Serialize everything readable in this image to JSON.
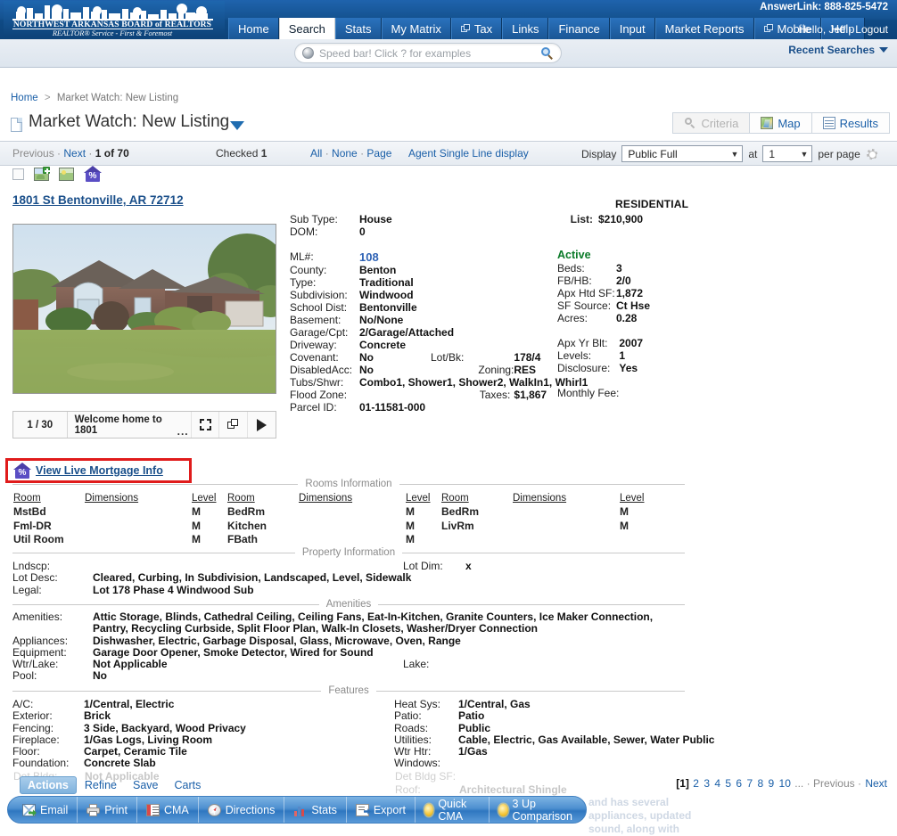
{
  "header": {
    "logo": {
      "line1": "NORTHWEST ARKANSAS BOARD of REALTORS",
      "line2": "REALTOR® Service - First & Foremost"
    },
    "nav": [
      {
        "label": "Home",
        "icon": "",
        "active": false
      },
      {
        "label": "Search",
        "icon": "",
        "active": true
      },
      {
        "label": "Stats",
        "icon": "",
        "active": false
      },
      {
        "label": "My Matrix",
        "icon": "",
        "active": false
      },
      {
        "label": "Tax",
        "icon": "window-icon",
        "active": false
      },
      {
        "label": "Links",
        "icon": "",
        "active": false
      },
      {
        "label": "Finance",
        "icon": "",
        "active": false
      },
      {
        "label": "Input",
        "icon": "",
        "active": false
      },
      {
        "label": "Market Reports",
        "icon": "",
        "active": false
      },
      {
        "label": "Mobile",
        "icon": "window-icon",
        "active": false
      },
      {
        "label": "Help",
        "icon": "",
        "active": false
      }
    ],
    "answerlink": "AnswerLink: 888-825-5472",
    "greeting": "Hello, Jeff",
    "greeting_sep": "·",
    "logout": "Logout"
  },
  "speedbar": {
    "placeholder": "Speed bar! Click ? for examples",
    "value": "",
    "recent_searches": "Recent Searches"
  },
  "breadcrumb": {
    "home": "Home",
    "separator": ">",
    "current": "Market Watch: New Listing"
  },
  "page": {
    "title": "Market Watch: New Listing"
  },
  "viewbuttons": [
    {
      "label": "Criteria",
      "icon": "magnifier-icon",
      "disabled": true
    },
    {
      "label": "Map",
      "icon": "map-icon",
      "disabled": false
    },
    {
      "label": "Results",
      "icon": "grid-icon",
      "disabled": false
    }
  ],
  "toolbar": {
    "previous": "Previous",
    "dot1": "·",
    "next": "Next",
    "dot2": "·",
    "position_prefix": "1 of ",
    "position_total": "70",
    "checked_label": "Checked",
    "checked_count": "1",
    "all": "All",
    "none": "None",
    "page": "Page",
    "agent_display": "Agent Single Line display",
    "display_label": "Display",
    "display_value": "Public Full",
    "at_label": "at",
    "per_page_value": "1",
    "per_page_label": "per page"
  },
  "listing": {
    "address": "1801 St Bentonville, AR 72712",
    "property_class": "RESIDENTIAL",
    "list_label": "List:",
    "list_price": "$210,900",
    "status": "Active",
    "photo_caption": {
      "counter": "1 / 30",
      "text": "Welcome home to 1801",
      "ellipsis": "..."
    },
    "mortgage_link": "View Live Mortgage Info",
    "left": [
      {
        "label": "Sub Type:",
        "value": "House"
      },
      {
        "label": "DOM:",
        "value": "0"
      }
    ],
    "main": [
      {
        "label": "ML#:",
        "value": "108",
        "link": true
      },
      {
        "label": "County:",
        "value": "Benton"
      },
      {
        "label": "Type:",
        "value": "Traditional"
      },
      {
        "label": "Subdivision:",
        "value": "Windwood"
      },
      {
        "label": "School Dist:",
        "value": "Bentonville"
      },
      {
        "label": "Basement:",
        "value": "No/None"
      },
      {
        "label": "Garage/Cpt:",
        "value": "2/Garage/Attached"
      },
      {
        "label": "Driveway:",
        "value": "Concrete"
      },
      {
        "label": "Covenant:",
        "value": "No",
        "label2": "Lot/Bk:",
        "value2": "178/4"
      },
      {
        "label": "DisabledAcc:",
        "value": "No",
        "label2": "Zoning:",
        "value2": "RES"
      },
      {
        "label": "Tubs/Shwr:",
        "value": "Combo1, Shower1, Shower2, WalkIn1, Whirl1"
      },
      {
        "label": "Flood Zone:",
        "value": "",
        "label2": "Taxes:",
        "value2": "$1,867"
      },
      {
        "label": "Parcel ID:",
        "value": "01-11581-000"
      }
    ],
    "right": [
      {
        "label": "Beds:",
        "value": "3"
      },
      {
        "label": "FB/HB:",
        "value": "2/0"
      },
      {
        "label": "Apx Htd SF:",
        "value": "1,872"
      },
      {
        "label": "SF Source:",
        "value": "Ct Hse"
      },
      {
        "label": "Acres:",
        "value": "0.28"
      }
    ],
    "right2": [
      {
        "label": "Apx Yr Blt:",
        "value": "2007"
      },
      {
        "label": "Levels:",
        "value": "1"
      },
      {
        "label": "Disclosure:",
        "value": "Yes"
      },
      {
        "label": "Monthly Fee:",
        "value": ""
      }
    ]
  },
  "sections": {
    "rooms_title": "Rooms Information",
    "property_title": "Property Information",
    "amenities_title": "Amenities",
    "features_title": "Features"
  },
  "rooms": {
    "headers": [
      "Room",
      "Dimensions",
      "Level"
    ],
    "columns": [
      [
        {
          "room": "MstBd",
          "dimensions": "",
          "level": "M"
        },
        {
          "room": "Fml-DR",
          "dimensions": "",
          "level": "M"
        },
        {
          "room": "Util Room",
          "dimensions": "",
          "level": "M"
        }
      ],
      [
        {
          "room": "BedRm",
          "dimensions": "",
          "level": "M"
        },
        {
          "room": "Kitchen",
          "dimensions": "",
          "level": "M"
        },
        {
          "room": "FBath",
          "dimensions": "",
          "level": "M"
        }
      ],
      [
        {
          "room": "BedRm",
          "dimensions": "",
          "level": "M"
        },
        {
          "room": "LivRm",
          "dimensions": "",
          "level": "M"
        }
      ]
    ]
  },
  "property_info": {
    "lndscp_label": "Lndscp:",
    "lndscp_value": "",
    "lotdim_label": "Lot Dim:",
    "lotdim_value": "x",
    "rows": [
      {
        "label": "Lot Desc:",
        "value": "Cleared, Curbing, In Subdivision, Landscaped, Level, Sidewalk"
      },
      {
        "label": "Legal:",
        "value": "Lot 178 Phase 4 Windwood Sub"
      }
    ]
  },
  "amenities": {
    "rows": [
      {
        "label": "Amenities:",
        "value": "Attic Storage, Blinds, Cathedral Ceiling, Ceiling Fans, Eat-In-Kitchen, Granite Counters, Ice Maker Connection, Pantry, Recycling Curbside, Split Floor Plan, Walk-In Closets, Washer/Dryer Connection"
      },
      {
        "label": "Appliances:",
        "value": "Dishwasher, Electric, Garbage Disposal, Glass, Microwave, Oven, Range"
      },
      {
        "label": "Equipment:",
        "value": "Garage Door Opener, Smoke Detector, Wired for Sound"
      },
      {
        "label": "Wtr/Lake:",
        "value": "Not Applicable"
      },
      {
        "label": "Pool:",
        "value": "No"
      }
    ],
    "lake_label": "Lake:",
    "lake_value": ""
  },
  "features": {
    "left": [
      {
        "label": "A/C:",
        "value": "1/Central, Electric"
      },
      {
        "label": "Exterior:",
        "value": "Brick"
      },
      {
        "label": "Fencing:",
        "value": "3 Side, Backyard, Wood Privacy"
      },
      {
        "label": "Fireplace:",
        "value": "1/Gas Logs, Living Room"
      },
      {
        "label": "Floor:",
        "value": "Carpet, Ceramic Tile"
      },
      {
        "label": "Foundation:",
        "value": "Concrete Slab"
      },
      {
        "label": "Det Bldg:",
        "value": "Not Applicable"
      }
    ],
    "right": [
      {
        "label": "Heat Sys:",
        "value": "1/Central, Gas"
      },
      {
        "label": "Patio:",
        "value": "Patio"
      },
      {
        "label": "Roads:",
        "value": "Public"
      },
      {
        "label": "Utilities:",
        "value": "Cable, Electric, Gas Available, Sewer, Water Public"
      },
      {
        "label": "Wtr Htr:",
        "value": "1/Gas"
      },
      {
        "label": "Windows:",
        "value": ""
      },
      {
        "label": "Det Bldg SF:",
        "value": ""
      },
      {
        "label": "Roof:",
        "value": "Architectural Shingle"
      }
    ]
  },
  "obscured_description": {
    "line1": "and has several",
    "line2": "appliances, updated",
    "line3": "sound, along with"
  },
  "action_tabs": [
    {
      "label": "Actions",
      "active": true
    },
    {
      "label": "Refine",
      "active": false
    },
    {
      "label": "Save",
      "active": false
    },
    {
      "label": "Carts",
      "active": false
    }
  ],
  "action_buttons": [
    {
      "label": "Email",
      "icon": "email-icon"
    },
    {
      "label": "Print",
      "icon": "printer-icon"
    },
    {
      "label": "CMA",
      "icon": "cma-icon"
    },
    {
      "label": "Directions",
      "icon": "compass-icon"
    },
    {
      "label": "Stats",
      "icon": "bar-chart-icon"
    },
    {
      "label": "Export",
      "icon": "export-icon"
    },
    {
      "label": "Quick CMA",
      "icon": "sun-icon"
    },
    {
      "label": "3 Up Comparison",
      "icon": "sun-icon"
    }
  ],
  "pagination": {
    "current": "[1]",
    "pages": [
      "2",
      "3",
      "4",
      "5",
      "6",
      "7",
      "8",
      "9",
      "10"
    ],
    "ellipsis": "...",
    "sep": "·",
    "previous": "Previous",
    "next": "Next"
  },
  "colors": {
    "nav_blue": "#14528f",
    "link_blue": "#1a5fa8",
    "active_green": "#0a7a28",
    "highlight_red": "#e01b1b",
    "action_bar_blue": "#4d8fd0"
  }
}
